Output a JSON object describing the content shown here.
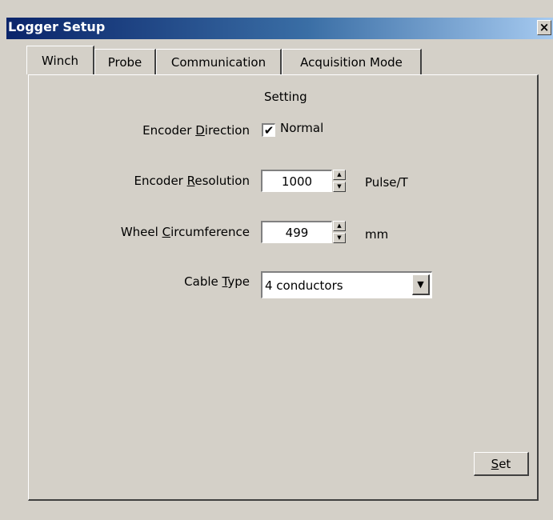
{
  "window": {
    "title": "Logger Setup",
    "close_glyph": "×"
  },
  "tabs": [
    {
      "label": "Winch",
      "active": true
    },
    {
      "label": "Probe",
      "active": false
    },
    {
      "label": "Communication",
      "active": false
    },
    {
      "label": "Acquisition Mode",
      "active": false
    }
  ],
  "panel": {
    "section_title": "Setting",
    "encoder_direction": {
      "label_pre": "Encoder ",
      "label_accel": "D",
      "label_post": "irection",
      "checkbox_label": "Normal",
      "checked": true,
      "check_glyph": "✔"
    },
    "encoder_resolution": {
      "label_pre": "Encoder ",
      "label_accel": "R",
      "label_post": "esolution",
      "value": "1000",
      "unit": "Pulse/T"
    },
    "wheel_circumference": {
      "label_pre": "Wheel ",
      "label_accel": "C",
      "label_post": "ircumference",
      "value": "499",
      "unit": "mm"
    },
    "cable_type": {
      "label_pre": "Cable ",
      "label_accel": "T",
      "label_post": "ype",
      "selected": "4 conductors"
    },
    "set_button": {
      "label_accel": "S",
      "label_post": "et"
    }
  },
  "icons": {
    "spin_up": "▲",
    "spin_down": "▼",
    "dropdown_arrow": "▼"
  },
  "colors": {
    "title_gradient_start": "#0a246a",
    "title_gradient_end": "#a6caf0",
    "face": "#d4d0c8"
  }
}
